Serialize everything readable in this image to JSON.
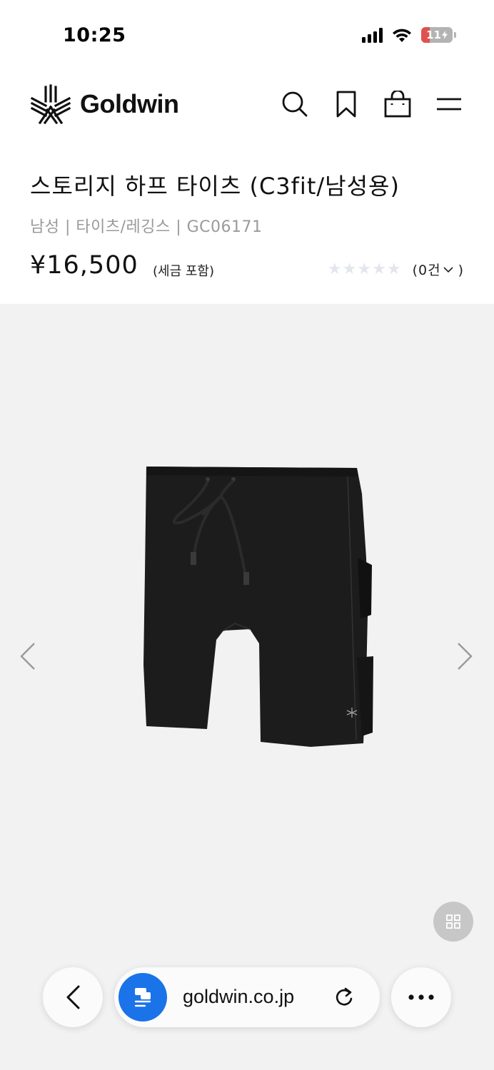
{
  "status_bar": {
    "time": "10:25",
    "battery_level": "11"
  },
  "header": {
    "brand": "Goldwin",
    "icons": [
      "search-icon",
      "bookmark-icon",
      "shopping-bag-icon",
      "menu-icon"
    ]
  },
  "product": {
    "title": "스토리지 하프 타이츠 (C3fit/남성용)",
    "meta": "남성 | 타이츠/레깅스 | GC06171",
    "price": "¥16,500",
    "tax_note": "(세금 포함)",
    "rating_stars": 0,
    "review_count": "(0건",
    "review_close": ")"
  },
  "gallery": {
    "prev_icon": "chevron-left-icon",
    "next_icon": "chevron-right-icon",
    "grid_icon": "grid-icon"
  },
  "browser": {
    "url": "goldwin.co.jp",
    "back_icon": "back-icon",
    "reload_icon": "reload-icon",
    "more_icon": "more-icon"
  },
  "colors": {
    "gallery_bg": "#f2f2f2",
    "battery": "#e0514f",
    "site_icon": "#1a73e8"
  }
}
